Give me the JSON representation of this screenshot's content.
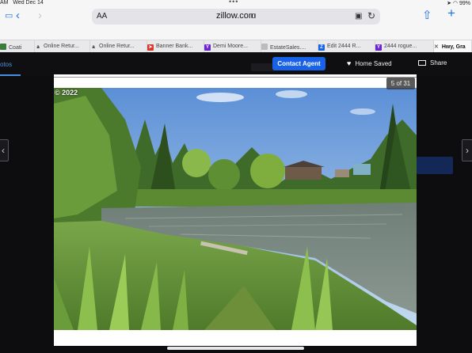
{
  "status_bar": {
    "time_date": "Wed Dec 14",
    "time_fragment": "AM",
    "battery": "99%"
  },
  "browser": {
    "text_size": "AA",
    "url": "zillow.com",
    "tabs": [
      {
        "label": "Coati",
        "favicon": "zillow-blue",
        "color": "#2f5fb3"
      },
      {
        "label": "Online Retur...",
        "favicon": "amazon",
        "color": "#222222"
      },
      {
        "label": "Online Retur...",
        "favicon": "amazon",
        "color": "#222222"
      },
      {
        "label": "Banner Bank...",
        "favicon": "banner",
        "color": "#d9382c"
      },
      {
        "label": "Demi Moore...",
        "favicon": "yahoo",
        "color": "#6b25c9"
      },
      {
        "label": "EstateSales....",
        "favicon": "estatesales",
        "color": "#aaaaaa"
      },
      {
        "label": "Edit 2444 R...",
        "favicon": "zillow",
        "color": "#1762e8"
      },
      {
        "label": "2444 rogue...",
        "favicon": "yahoo",
        "color": "#6b25c9"
      },
      {
        "label": "Hwy, Gra",
        "favicon": "close",
        "color": "#111111"
      }
    ]
  },
  "page": {
    "photos_tab": "otos",
    "contact_agent": "Contact Agent",
    "home_saved": "Home Saved",
    "share": "Share"
  },
  "gallery": {
    "counter": "5 of 31",
    "copyright": "© 2022"
  },
  "colors": {
    "accent": "#1762e8",
    "page_bg": "#0d0d10"
  }
}
